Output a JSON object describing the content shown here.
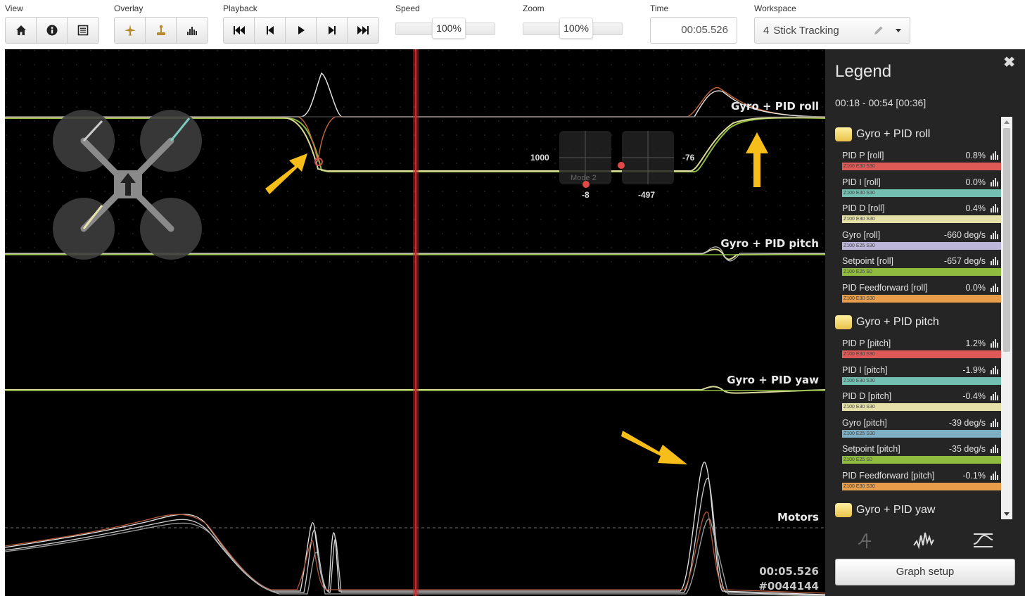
{
  "toolbar": {
    "view": {
      "label": "View",
      "buttons": [
        "home-icon",
        "info-icon",
        "list-icon"
      ]
    },
    "overlay": {
      "label": "Overlay",
      "buttons": [
        "aircraft-icon",
        "stick-icon",
        "spectrum-icon"
      ]
    },
    "playback": {
      "label": "Playback",
      "buttons": [
        "skip-start-icon",
        "step-back-icon",
        "play-icon",
        "step-forward-icon",
        "skip-end-icon"
      ]
    },
    "speed": {
      "label": "Speed",
      "value": "100%",
      "level": 0.5
    },
    "zoom": {
      "label": "Zoom",
      "value": "100%",
      "level": 0.5
    },
    "time": {
      "label": "Time",
      "value": "00:05.526"
    },
    "workspace": {
      "label": "Workspace",
      "number": "4",
      "name": "Stick Tracking"
    }
  },
  "graph": {
    "labels": {
      "roll": "Gyro + PID roll",
      "pitch": "Gyro + PID pitch",
      "yaw": "Gyro + PID yaw",
      "motors": "Motors"
    },
    "sticks": {
      "left_val": "1000",
      "right_val": "-76",
      "mode": "Mode 2",
      "left_bottom": "-8",
      "right_bottom": "-497"
    },
    "footer": {
      "time": "00:05.526",
      "frame": "#0044144"
    },
    "colors": {
      "cursor": "#c0272d",
      "arrow": "#f7bd18",
      "gyro": "#d8d89a",
      "setpoint": "#8fbc3f"
    }
  },
  "legend": {
    "title": "Legend",
    "range": "00:18 - 00:54 [00:36]",
    "groups": [
      {
        "name": "Gyro + PID roll",
        "fields": [
          {
            "name": "PID P [roll]",
            "value": "0.8%",
            "color": "#dd5a57",
            "tag": "Z100 E30 S30"
          },
          {
            "name": "PID I [roll]",
            "value": "0.0%",
            "color": "#73c0b3",
            "tag": "Z100 E30 S30"
          },
          {
            "name": "PID D [roll]",
            "value": "0.4%",
            "color": "#e4e0a8",
            "tag": "Z100 E30 S30"
          },
          {
            "name": "Gyro [roll]",
            "value": "-660 deg/s",
            "color": "#bcb6da",
            "tag": "Z100 E25 S30"
          },
          {
            "name": "Setpoint [roll]",
            "value": "-657 deg/s",
            "color": "#8fbc3f",
            "tag": "Z100 E25 S0"
          },
          {
            "name": "PID Feedforward [roll]",
            "value": "0.0%",
            "color": "#e89d4a",
            "tag": "Z100 E30 S30"
          }
        ]
      },
      {
        "name": "Gyro + PID pitch",
        "fields": [
          {
            "name": "PID P [pitch]",
            "value": "1.2%",
            "color": "#dd5a57",
            "tag": "Z100 E30 S30"
          },
          {
            "name": "PID I [pitch]",
            "value": "-1.9%",
            "color": "#73c0b3",
            "tag": "Z100 E30 S30"
          },
          {
            "name": "PID D [pitch]",
            "value": "-0.4%",
            "color": "#e4e0a8",
            "tag": "Z100 E30 S30"
          },
          {
            "name": "Gyro [pitch]",
            "value": "-39 deg/s",
            "color": "#7dafc5",
            "tag": "Z100 E25 S30"
          },
          {
            "name": "Setpoint [pitch]",
            "value": "-35 deg/s",
            "color": "#8fbc3f",
            "tag": "Z100 E25 S0"
          },
          {
            "name": "PID Feedforward [pitch]",
            "value": "-0.1%",
            "color": "#e89d4a",
            "tag": "Z100 E30 S30"
          }
        ]
      },
      {
        "name": "Gyro + PID yaw",
        "fields": []
      }
    ],
    "footer_icons": [
      "stick-trace-icon",
      "noise-trace-icon",
      "filter-trace-icon"
    ],
    "setup_label": "Graph setup"
  }
}
